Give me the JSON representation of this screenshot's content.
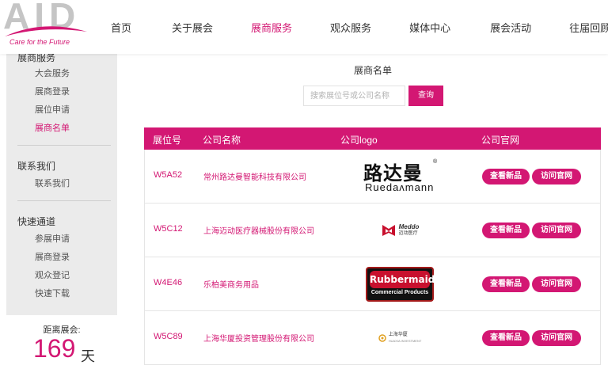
{
  "header": {
    "logo_text": "AID",
    "logo_tagline": "Care for the Future",
    "nav": [
      {
        "label": "首页"
      },
      {
        "label": "关于展会"
      },
      {
        "label": "展商服务",
        "active": true
      },
      {
        "label": "观众服务"
      },
      {
        "label": "媒体中心"
      },
      {
        "label": "展会活动"
      },
      {
        "label": "往届回顾"
      }
    ]
  },
  "sidebar": {
    "section1": {
      "title": "展商服务",
      "items": [
        "大会服务",
        "展商登录",
        "展位申请",
        "展商名单"
      ],
      "active_index": 3
    },
    "section2": {
      "title": "联系我们",
      "items": [
        "联系我们"
      ]
    },
    "section3": {
      "title": "快速通道",
      "items": [
        "参展申请",
        "展商登录",
        "观众登记",
        "快速下载"
      ]
    },
    "countdown": {
      "label": "距离展会:",
      "days": "169",
      "unit": "天"
    }
  },
  "main": {
    "title": "展商名单",
    "search": {
      "placeholder": "搜索展位号或公司名称",
      "button": "查询"
    },
    "table": {
      "headers": [
        "展位号",
        "公司名称",
        "公司logo",
        "公司官网"
      ],
      "rows": [
        {
          "booth": "W5A52",
          "company": "常州路达曼智能科技有限公司",
          "logo": "ruedamann-logo",
          "logo_zh": "路达曼",
          "logo_en": "Ruedaʌmann",
          "logo_reg": "®"
        },
        {
          "booth": "W5C12",
          "company": "上海迈动医疗器械股份有限公司",
          "logo": "meddo-logo",
          "logo_en": "Meddo",
          "logo_zh": "迈动医疗"
        },
        {
          "booth": "W4E46",
          "company": "乐柏美商务用品",
          "logo": "rubbermaid-logo",
          "logo_top": "Rubbermaid",
          "logo_bottom": "Commercial Products"
        },
        {
          "booth": "W5C89",
          "company": "上海华厦投资管理股份有限公司",
          "logo": "huaxia-logo",
          "logo_zh": "上海华厦",
          "logo_sub": "HUAXIA INVESTMENT"
        }
      ],
      "btn_new": "查看新品",
      "btn_site": "访问官网"
    }
  },
  "colors": {
    "accent": "#d31773",
    "sidebar_bg": "#ebebeb"
  }
}
